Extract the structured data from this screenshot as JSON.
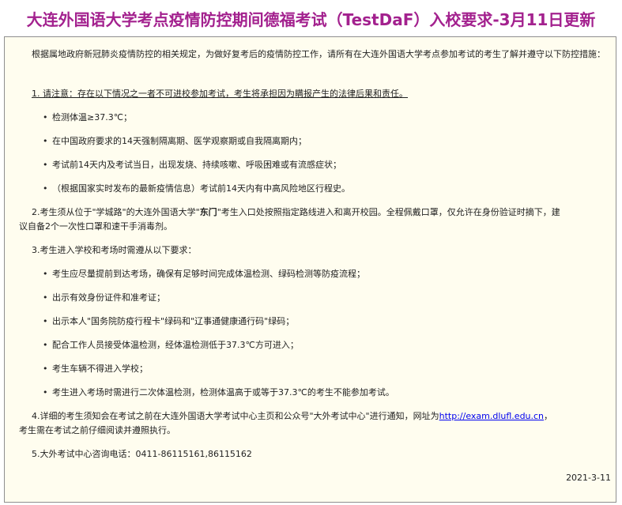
{
  "title": "大连外国语大学考点疫情防控期间德福考试（TestDaF）入校要求-3月11日更新",
  "intro": "根据属地政府新冠肺炎疫情防控的相关规定，为做好复考后的疫情防控工作，请所有在大连外国语大学考点参加考试的考生了解并遵守以下防控措施：",
  "section1": {
    "title": "1. 请注意：存在以下情况之一者不可进校参加考试，考生将承担因为瞒报产生的法律后果和责任。",
    "items": [
      "检测体温≥37.3℃；",
      "在中国政府要求的14天强制隔离期、医学观察期或自我隔离期内；",
      "考试前14天内及考试当日，出现发烧、持续咳嗽、呼吸困难或有流感症状；",
      "（根据国家实时发布的最新疫情信息）考试前14天内有中高风险地区行程史。"
    ]
  },
  "section2": {
    "line1_pre": "2.考生须从位于\"学城路\"的大连外国语大学\"",
    "line1_bold": "东门",
    "line1_post": "\"考生入口处按照指定路线进入和离开校园。全程佩戴口罩，仅允许在身份验证时摘下，建",
    "line2": "议自备2个一次性口罩和速干手消毒剂。"
  },
  "section3": {
    "title": "3.考生进入学校和考场时需遵从以下要求：",
    "items": [
      "考生应尽量提前到达考场，确保有足够时间完成体温检测、绿码检测等防疫流程；",
      "出示有效身份证件和准考证；",
      "出示本人\"国务院防疫行程卡\"绿码和\"辽事通健康通行码\"绿码；",
      "配合工作人员接受体温检测，经体温检测低于37.3℃方可进入；",
      "考生车辆不得进入学校；",
      "考生进入考场时需进行二次体温检测，检测体温高于或等于37.3℃的考生不能参加考试。"
    ]
  },
  "section4": {
    "text": "4.详细的考生须知会在考试之前在大连外国语大学考试中心主页和公众号\"大外考试中心\"进行通知，网址为",
    "link": "http://exam.dlufl.edu.cn",
    "text_after": "，",
    "line2": "考生需在考试之前仔细阅读并遵照执行。"
  },
  "section5": "5.大外考试中心咨询电话：0411-86115161,86115162",
  "date": "2021-3-11"
}
